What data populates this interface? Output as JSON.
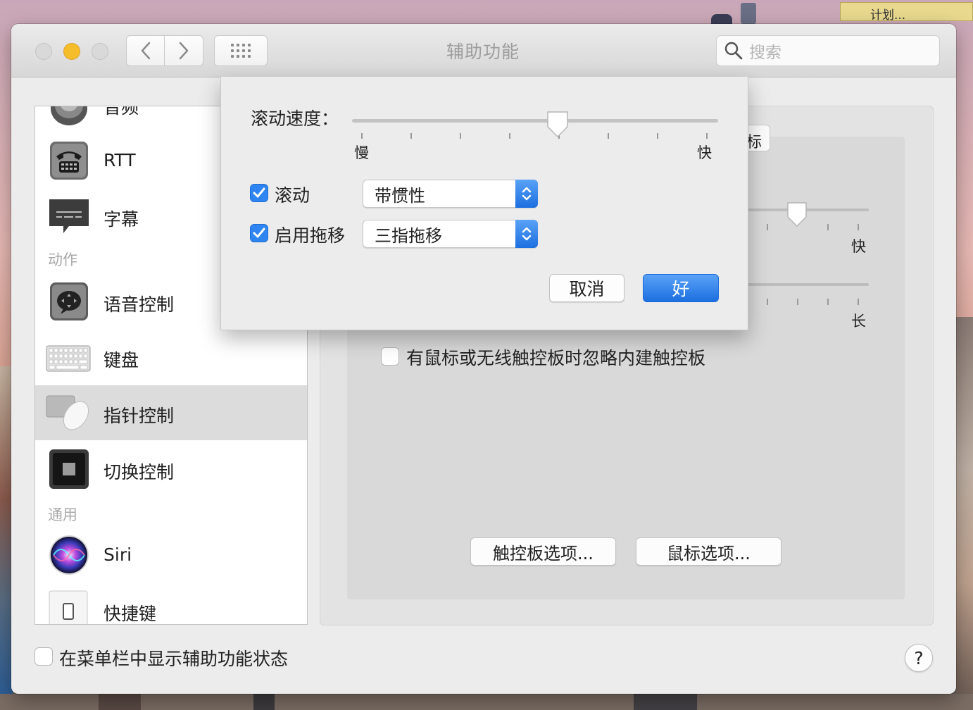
{
  "desktop": {
    "tooltip": "计划..."
  },
  "window": {
    "title": "辅助功能",
    "search_placeholder": "搜索",
    "nav_back": "‹",
    "nav_forward": "›"
  },
  "sidebar": {
    "partial_top_label": "音频",
    "items": [
      {
        "label": "RTT",
        "icon": "rtt-phone-icon"
      },
      {
        "label": "字幕",
        "icon": "captions-icon"
      },
      {
        "label": "语音控制",
        "icon": "voice-control-icon"
      },
      {
        "label": "键盘",
        "icon": "keyboard-icon"
      },
      {
        "label": "指针控制",
        "icon": "pointer-control-icon",
        "selected": true
      },
      {
        "label": "切换控制",
        "icon": "switch-control-icon"
      },
      {
        "label": "Siri",
        "icon": "siri-icon"
      },
      {
        "label": "快捷键",
        "icon": "shortcut-icon"
      }
    ],
    "sections": {
      "motor": "动作",
      "general": "通用"
    }
  },
  "panel": {
    "tab_peek": "标",
    "slider1_right": "快",
    "slider2_right": "长",
    "ignore_builtin_trackpad": {
      "label": "有鼠标或无线触控板时忽略内建触控板",
      "checked": false
    },
    "trackpad_options_button": "触控板选项...",
    "mouse_options_button": "鼠标选项..."
  },
  "sheet": {
    "scroll_speed_label": "滚动速度：",
    "scroll_speed_value": 0.57,
    "scroll_min_label": "慢",
    "scroll_max_label": "快",
    "scrolling": {
      "label": "滚动",
      "checked": true,
      "selected": "带惯性"
    },
    "dragging": {
      "label": "启用拖移",
      "checked": true,
      "selected": "三指拖移"
    },
    "cancel_button": "取消",
    "ok_button": "好"
  },
  "footer": {
    "show_in_menubar": {
      "label": "在菜单栏中显示辅助功能状态",
      "checked": false
    },
    "help": "?"
  },
  "colors": {
    "accent": "#2e84f0",
    "selected_row": "#dcdcdc"
  }
}
